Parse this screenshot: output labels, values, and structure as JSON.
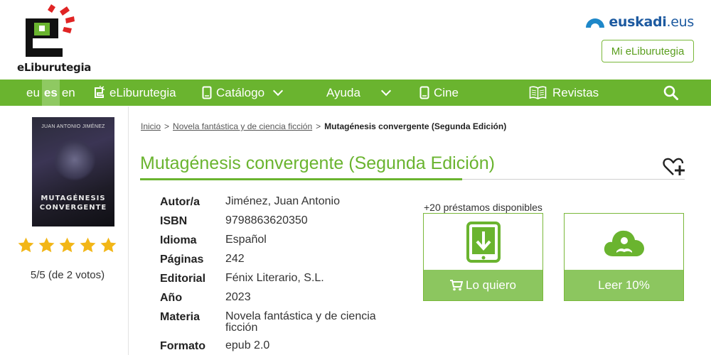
{
  "brand": {
    "logo_text": "eLiburutegia",
    "gov_name": "euskadi",
    "gov_tld": ".eus",
    "my_library_button": "Mi eLiburutegia",
    "accent_color": "#6ab42f",
    "gov_color": "#1d5aa0"
  },
  "nav": {
    "languages": [
      "eu",
      "es",
      "en"
    ],
    "active_language": "es",
    "items": [
      {
        "label": "eLiburutegia",
        "icon": "eliburutegia-icon"
      },
      {
        "label": "Catálogo",
        "icon": "tablet-icon",
        "has_dropdown": true
      },
      {
        "label": "Ayuda",
        "has_dropdown": true
      },
      {
        "label": "Cine",
        "icon": "phone-icon"
      },
      {
        "label": "Revistas",
        "icon": "magazine-icon"
      }
    ],
    "search_icon": "search-icon"
  },
  "book": {
    "cover_author": "JUAN ANTONIO JIMÉNEZ",
    "cover_title_line1": "MUTAGÉNESIS",
    "cover_title_line2": "CONVERGENTE",
    "stars": 5,
    "rating_text": "5/5 (de 2 votos)"
  },
  "breadcrumb": {
    "items": [
      "Inicio",
      "Novela fantástica y de ciencia ficción"
    ],
    "current": "Mutagénesis convergente (Segunda Edición)",
    "separator": ">"
  },
  "title": "Mutagénesis convergente (Segunda Edición)",
  "meta": [
    {
      "label": "Autor/a",
      "value": "Jiménez, Juan Antonio"
    },
    {
      "label": "ISBN",
      "value": "9798863620350"
    },
    {
      "label": "Idioma",
      "value": "Español"
    },
    {
      "label": "Páginas",
      "value": "242"
    },
    {
      "label": "Editorial",
      "value": "Fénix Literario, S.L."
    },
    {
      "label": "Año",
      "value": "2023"
    },
    {
      "label": "Materia",
      "value": "Novela fantástica y de ciencia ficción"
    },
    {
      "label": "Formato",
      "value": "epub 2.0"
    }
  ],
  "loans": {
    "available_text": "+20 préstamos disponibles",
    "borrow_button": "Lo quiero",
    "preview_button": "Leer 10%"
  }
}
